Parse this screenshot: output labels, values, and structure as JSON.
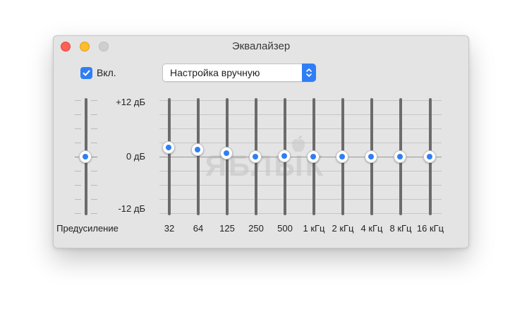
{
  "window": {
    "title": "Эквалайзер"
  },
  "onoff": {
    "label": "Вкл.",
    "checked": true
  },
  "preset": {
    "selected": "Настройка вручную"
  },
  "scale": {
    "top": "+12 дБ",
    "middle": "0 дБ",
    "bottom": "-12 дБ",
    "min_db": -12,
    "max_db": 12
  },
  "preamp": {
    "label": "Предусиление",
    "value_db": 0
  },
  "bands": [
    {
      "label": "32",
      "value_db": 2
    },
    {
      "label": "64",
      "value_db": 1.5
    },
    {
      "label": "125",
      "value_db": 0.8
    },
    {
      "label": "250",
      "value_db": 0
    },
    {
      "label": "500",
      "value_db": 0.2
    },
    {
      "label": "1 кГц",
      "value_db": 0
    },
    {
      "label": "2 кГц",
      "value_db": 0
    },
    {
      "label": "4 кГц",
      "value_db": 0
    },
    {
      "label": "8 кГц",
      "value_db": 0
    },
    {
      "label": "16 кГц",
      "value_db": 0
    }
  ],
  "watermark": {
    "text": "ЯБЛЫК"
  },
  "colors": {
    "accent": "#2f7ef6",
    "close": "#fe5f57",
    "minimize": "#febc2e",
    "zoom": "#cfcfcf"
  }
}
